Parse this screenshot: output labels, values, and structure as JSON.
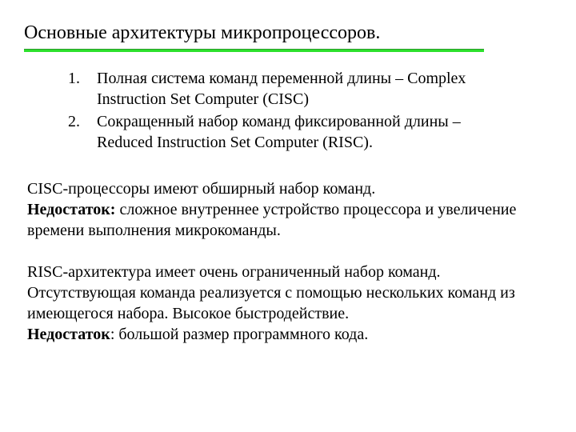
{
  "title": "Основные архитектуры микропроцессоров.",
  "list": [
    {
      "num": "1.",
      "text": "Полная система команд переменной длины – Complex Instruction Set Computer (CISC)"
    },
    {
      "num": "2.",
      "text": "Сокращенный набор команд фиксированной длины – Reduced Instruction Set Computer (RISC)."
    }
  ],
  "cisc": {
    "line1": "CISC-процессоры имеют обширный набор команд.",
    "drawback_label": "Недостаток:",
    "drawback_text": " сложное внутреннее устройство процессора и увеличение времени выполнения микрокоманды."
  },
  "risc": {
    "line1": "RISC-архитектура имеет очень ограниченный набор команд. Отсутствующая команда реализуется с помощью нескольких команд из имеющегося набора. Высокое быстродействие.",
    "drawback_label": "Недостаток",
    "drawback_text": ": большой размер программного кода."
  }
}
